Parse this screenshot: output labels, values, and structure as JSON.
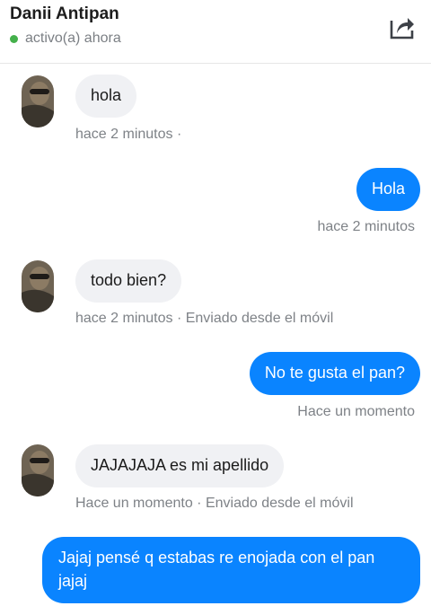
{
  "header": {
    "contact_name": "Danii Antipan",
    "status_text": "activo(a) ahora",
    "status_color": "#44b04b",
    "share_icon": "share-icon"
  },
  "messages": [
    {
      "direction": "in",
      "text": "hola",
      "meta": "hace 2 minutos ·"
    },
    {
      "direction": "out",
      "text": "Hola",
      "meta": "hace 2 minutos"
    },
    {
      "direction": "in",
      "text": "todo bien?",
      "meta": "hace 2 minutos · Enviado desde el móvil"
    },
    {
      "direction": "out",
      "text": "No te gusta el pan?",
      "meta": "Hace un momento"
    },
    {
      "direction": "in",
      "text": "JAJAJAJA es mi apellido",
      "meta": "Hace un momento · Enviado desde el móvil"
    },
    {
      "direction": "out",
      "text": "Jajaj pensé q estabas re enojada con el pan jajaj",
      "meta": ""
    }
  ],
  "colors": {
    "outgoing_bubble": "#0a84ff",
    "incoming_bubble": "#f0f1f4",
    "meta_text": "#7e8287"
  }
}
